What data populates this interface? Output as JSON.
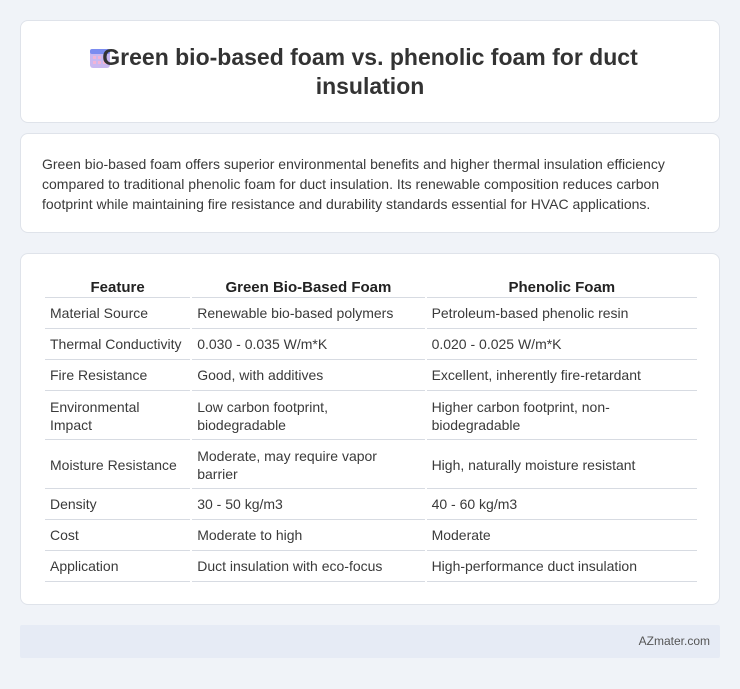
{
  "header": {
    "title": "Green bio-based foam vs. phenolic foam for duct insulation",
    "icon": "calendar-icon"
  },
  "intro": {
    "text": "Green bio-based foam offers superior environmental benefits and higher thermal insulation efficiency compared to traditional phenolic foam for duct insulation. Its renewable composition reduces carbon footprint while maintaining fire resistance and durability standards essential for HVAC applications."
  },
  "table": {
    "headers": [
      "Feature",
      "Green Bio-Based Foam",
      "Phenolic Foam"
    ],
    "rows": [
      [
        "Material Source",
        "Renewable bio-based polymers",
        "Petroleum-based phenolic resin"
      ],
      [
        "Thermal Conductivity",
        "0.030 - 0.035 W/m*K",
        "0.020 - 0.025 W/m*K"
      ],
      [
        "Fire Resistance",
        "Good, with additives",
        "Excellent, inherently fire-retardant"
      ],
      [
        "Environmental Impact",
        "Low carbon footprint, biodegradable",
        "Higher carbon footprint, non-biodegradable"
      ],
      [
        "Moisture Resistance",
        "Moderate, may require vapor barrier",
        "High, naturally moisture resistant"
      ],
      [
        "Density",
        "30 - 50 kg/m3",
        "40 - 60 kg/m3"
      ],
      [
        "Cost",
        "Moderate to high",
        "Moderate"
      ],
      [
        "Application",
        "Duct insulation with eco-focus",
        "High-performance duct insulation"
      ]
    ]
  },
  "footer": {
    "brand": "AZmater.com"
  }
}
